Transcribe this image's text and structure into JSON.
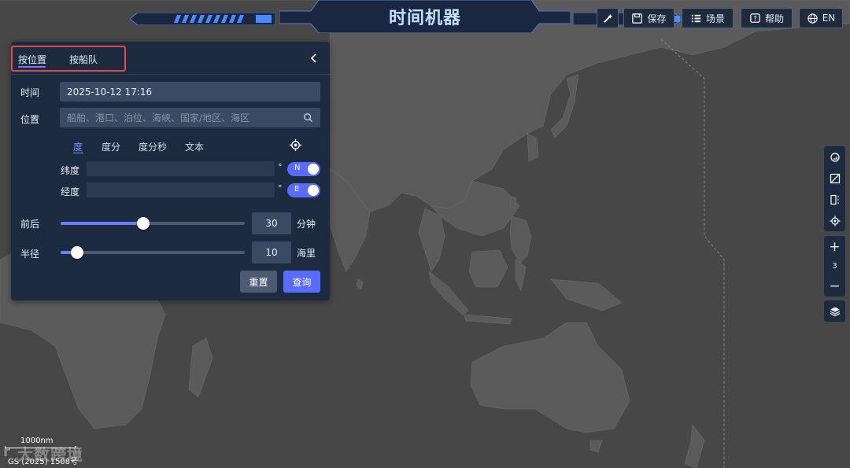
{
  "header": {
    "title": "时间机器",
    "buttons": {
      "tool_icon": "magic-wand-icon",
      "save": "保存",
      "scene": "场景",
      "help": "帮助",
      "language": "EN"
    }
  },
  "panel": {
    "tabs": [
      "按位置",
      "按船队"
    ],
    "active_tab": "按位置",
    "time_label": "时间",
    "time_value": "2025-10-12 17:16",
    "location_label": "位置",
    "location_placeholder": "船舶、港口、泊位、海峡、国家/地区、海区",
    "coord_modes": [
      "度",
      "度分",
      "度分秒",
      "文本"
    ],
    "active_coord_mode": "度",
    "lat_label": "纬度",
    "lat_value": "",
    "lat_dir": "N",
    "lon_label": "经度",
    "lon_value": "",
    "lon_dir": "E",
    "degree_symbol": "°",
    "before_after_label": "前后",
    "before_after_value": "30",
    "before_after_unit": "分钟",
    "before_after_fraction": 0.45,
    "radius_label": "半径",
    "radius_value": "10",
    "radius_unit": "海里",
    "radius_fraction": 0.09,
    "reset_label": "重置",
    "query_label": "查询"
  },
  "map_tools": {
    "zoom_level": "3",
    "zoom_in": "+",
    "zoom_out": "−"
  },
  "footer": {
    "scale_text": "1000nm",
    "copyright": "GS (2025) 1508号",
    "watermark": "大数跨境"
  },
  "colors": {
    "accent": "#5a6cff",
    "panel_bg": "#1d2b40",
    "land": "#5a5a5a",
    "sea": "#484848",
    "highlight_box": "#e34a4a"
  }
}
